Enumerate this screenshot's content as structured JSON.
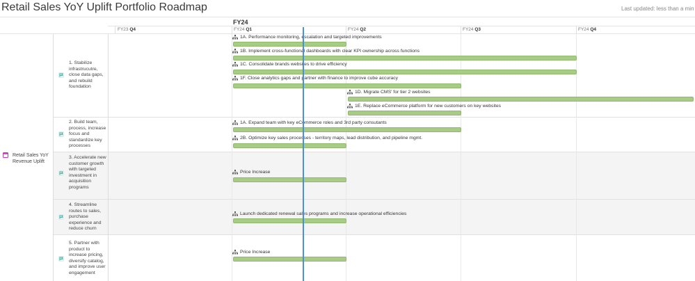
{
  "page": {
    "title": "Retail Sales YoY Uplift Portfolio Roadmap",
    "last_updated": "Last updated: less than a minute ago"
  },
  "timeline": {
    "fiscal_year": "FY24",
    "quarters": [
      {
        "fy": "FY23",
        "q": "Q4"
      },
      {
        "fy": "FY24",
        "q": "Q1"
      },
      {
        "fy": "FY24",
        "q": "Q2"
      },
      {
        "fy": "FY24",
        "q": "Q3"
      },
      {
        "fy": "FY24",
        "q": "Q4"
      }
    ]
  },
  "colors": {
    "bar": "#a8cc86",
    "today_line": "#4a90d9",
    "goal_icon": "#c23ab5",
    "objective_icon": "#2f9c94"
  },
  "goal": {
    "label": "Retail Sales YoY Revenue Uplift",
    "icon": "goal-icon"
  },
  "objectives": [
    {
      "label": "1. Stabilize infrastrucutre, close data gaps, and rebuild foundation",
      "icon": "flag-icon",
      "tasks": [
        {
          "label": "1A. Performance monitoring, escalation and targeted improvements",
          "start": "FY24 Q1",
          "end": "FY24 Q1"
        },
        {
          "label": "1B. Implement cross-functional dashboards with clear KPI ownership across functions",
          "start": "FY24 Q1",
          "end": "FY24 Q3"
        },
        {
          "label": "1C. Consolidate brands websites to drive efficiency",
          "start": "FY24 Q1",
          "end": "FY24 Q3"
        },
        {
          "label": "1F. Close analytics gaps and partner with finance to improve cube accuracy",
          "start": "FY24 Q1",
          "end": "FY24 Q2"
        },
        {
          "label": "1D. Migrate CMS' for tier 2 websites",
          "start": "FY24 Q2",
          "end": "FY24 Q4"
        },
        {
          "label": "1E. Replace eCommerce platform for new customers on key websites",
          "start": "FY24 Q2",
          "end": "FY24 Q2"
        }
      ]
    },
    {
      "label": "2. Build team, process, increase focus and standardize key processes",
      "icon": "flag-icon",
      "tasks": [
        {
          "label": "1A. Expand team with key eCommerce roles and 3rd party consutants",
          "start": "FY24 Q1",
          "end": "FY24 Q2"
        },
        {
          "label": "2B. Optimize key sales processes - territory maps, lead distribution, and pipeline mgmt.",
          "start": "FY24 Q1",
          "end": "FY24 Q1"
        }
      ]
    },
    {
      "label": "3. Accelerate new customer growth with targeted investment in acquisition programs",
      "icon": "flag-icon",
      "tasks": [
        {
          "label": "Price Increase",
          "start": "FY24 Q1",
          "end": "FY24 Q1"
        }
      ]
    },
    {
      "label": "4. Streamline routes to sales, purchase experience and reduce churn",
      "icon": "flag-icon",
      "tasks": [
        {
          "label": "Launch dedicated renewal sales programs and increase operational efficiencies",
          "start": "FY24 Q1",
          "end": "FY24 Q1"
        }
      ]
    },
    {
      "label": "5. Partner with product to increase pricing, diversify catalog, and improve user engagement",
      "icon": "flag-icon",
      "tasks": [
        {
          "label": "Price Increase",
          "start": "FY24 Q1",
          "end": "FY24 Q1"
        }
      ]
    }
  ]
}
